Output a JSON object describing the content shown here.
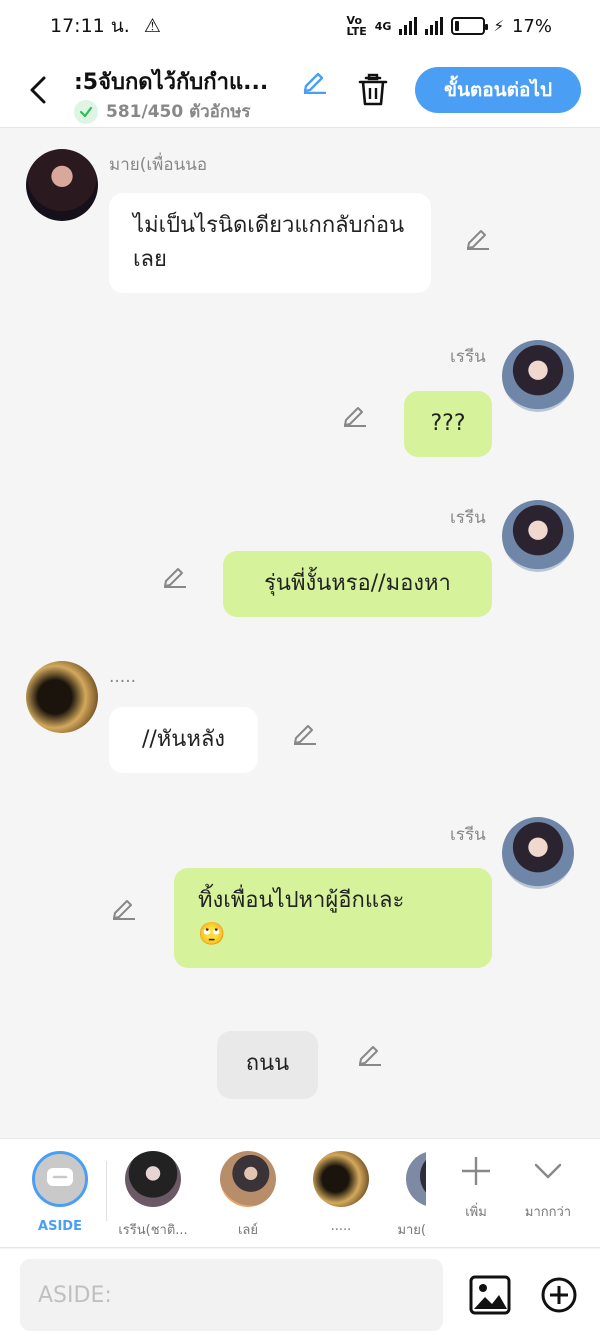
{
  "status_bar": {
    "time": "17:11 น.",
    "network": "4G",
    "battery_pct": "17%",
    "battery_level": 0.17
  },
  "header": {
    "title": ":5จับกดไว้กับกำแ...",
    "char_count": "581/450 ตัวอักษร",
    "next_button": "ขั้นตอนต่อไป",
    "accent_color": "#4a9ff5"
  },
  "messages": [
    {
      "side": "left",
      "sender": "มาย(เพื่อนนอ",
      "text": "ไม่เป็นไรนิดเดียวแกกลับก่อนเลย",
      "avatar": "girl-dark-avatar"
    },
    {
      "side": "right",
      "sender": "เรรีน",
      "text": "???",
      "avatar": "girl-anime-avatar"
    },
    {
      "side": "right",
      "sender": "เรรีน",
      "text": "รุ่นพี่งั้นหรอ//มองหา",
      "avatar": "girl-anime-avatar"
    },
    {
      "side": "left",
      "sender": ".....",
      "text": "//หันหลัง",
      "avatar": "shadow-avatar"
    },
    {
      "side": "right",
      "sender": "เรรีน",
      "text": "ทิ้งเพื่อนไปหาผู้อีกและ",
      "emoji": "🙄",
      "avatar": "girl-anime-avatar"
    },
    {
      "side": "center",
      "text": "ถนน"
    }
  ],
  "characters": [
    {
      "label": "ASIDE",
      "selected": true
    },
    {
      "label": "เรรีน(ชาติ..."
    },
    {
      "label": "เลย์"
    },
    {
      "label": "....."
    },
    {
      "label": "มาย("
    }
  ],
  "tools": {
    "add_label": "เพิ่ม",
    "more_label": "มากกว่า"
  },
  "input": {
    "placeholder": "ASIDE:"
  },
  "colors": {
    "bubble_right": "#d6f39b",
    "bubble_left": "#ffffff",
    "bubble_aside": "#e9e9e9"
  }
}
